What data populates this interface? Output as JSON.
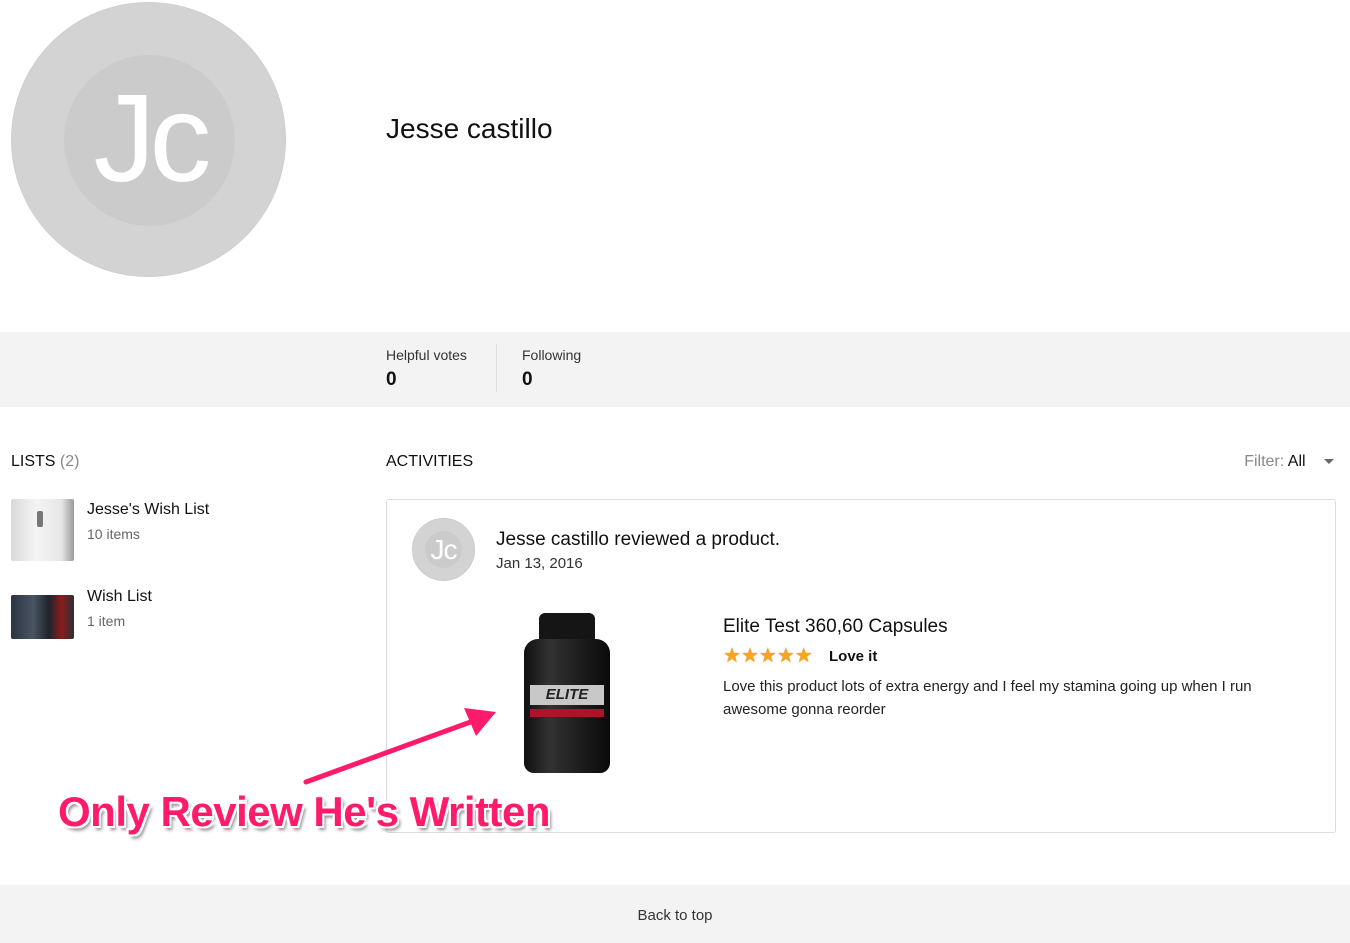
{
  "profile": {
    "initials": "Jc",
    "name": "Jesse castillo"
  },
  "stats": [
    {
      "label": "Helpful votes",
      "value": "0"
    },
    {
      "label": "Following",
      "value": "0"
    }
  ],
  "lists": {
    "heading": "LISTS",
    "count": "(2)",
    "items": [
      {
        "name": "Jesse's Wish List",
        "count": "10 items"
      },
      {
        "name": "Wish List",
        "count": "1 item"
      }
    ]
  },
  "activities": {
    "heading": "ACTIVITIES",
    "filter_label": "Filter:",
    "filter_value": "All",
    "card": {
      "avatar_initials": "Jc",
      "title": "Jesse castillo reviewed a product.",
      "date": "Jan 13, 2016",
      "product_title": "Elite Test 360,60 Capsules",
      "product_label": "ELITE",
      "rating": 5,
      "review_headline": "Love it",
      "review_text": "Love this product lots of extra energy and I feel my stamina going up when I run awesome gonna reorder"
    }
  },
  "annotation": {
    "text": "Only Review He's Written",
    "color": "#ff1b6b"
  },
  "footer": {
    "back_to_top": "Back to top"
  }
}
